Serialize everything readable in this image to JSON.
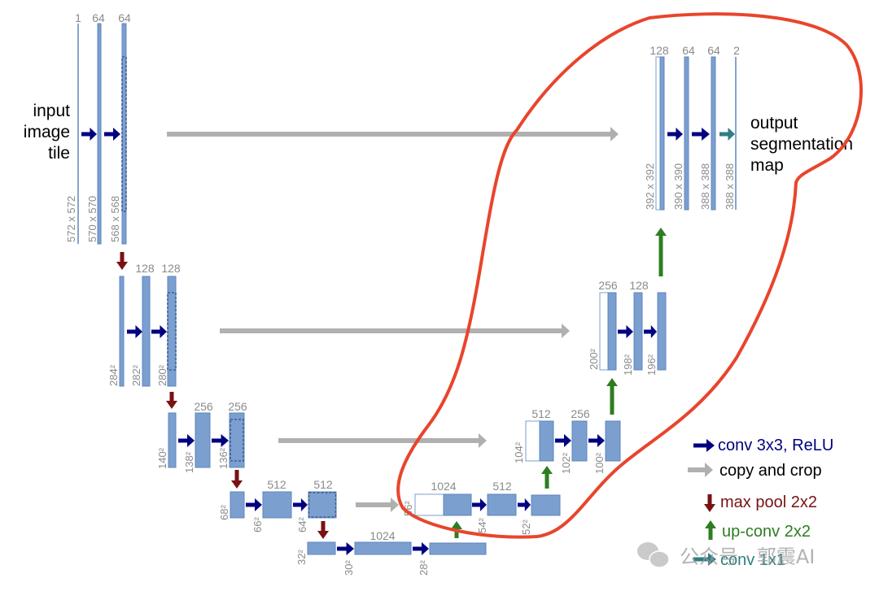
{
  "input_label": [
    "input",
    "image",
    "tile"
  ],
  "output_label": [
    "output",
    "segmentation",
    "map"
  ],
  "channels": {
    "l1_enc": [
      "1",
      "64",
      "64"
    ],
    "l2_enc": [
      "128",
      "128"
    ],
    "l3_enc": [
      "256",
      "256"
    ],
    "l4_enc": [
      "512",
      "512"
    ],
    "l5": [
      "1024"
    ],
    "l4_dec": [
      "1024",
      "512"
    ],
    "l3_dec": [
      "512",
      "256"
    ],
    "l2_dec": [
      "256",
      "128"
    ],
    "l1_dec": [
      "128",
      "64",
      "64",
      "2"
    ]
  },
  "sizes": {
    "l1_enc": [
      "572 x 572",
      "570 x 570",
      "568 x 568"
    ],
    "l2_enc": [
      "284²",
      "282²",
      "280²"
    ],
    "l3_enc": [
      "140²",
      "138²",
      "136²"
    ],
    "l4_enc": [
      "68²",
      "66²",
      "64²"
    ],
    "l5": [
      "32²",
      "30²",
      "28²"
    ],
    "l4_dec": [
      "56²",
      "54²",
      "52²"
    ],
    "l3_dec": [
      "104²",
      "102²",
      "100²"
    ],
    "l2_dec": [
      "200²",
      "198²",
      "196²"
    ],
    "l1_dec": [
      "392 x 392",
      "390 x 390",
      "388 x 388",
      "388 x 388"
    ]
  },
  "legend": [
    {
      "label": "conv 3x3, ReLU",
      "color": "#000080",
      "icon": "right-arrow-icon"
    },
    {
      "label": "copy and crop",
      "color": "#000000",
      "icon": "gray-right-arrow-icon"
    },
    {
      "label": "max pool 2x2",
      "color": "#7a1212",
      "icon": "down-arrow-icon"
    },
    {
      "label": "up-conv 2x2",
      "color": "#2e7d22",
      "icon": "up-arrow-icon"
    },
    {
      "label": "conv 1x1",
      "color": "#2f7f80",
      "icon": "teal-right-arrow-icon"
    }
  ],
  "watermark": {
    "text": "公众号 · 郭震AI",
    "icon": "wechat-icon"
  },
  "colors": {
    "feature_map": "#7b9fcf",
    "conv": "#000080",
    "copy": "#b0b0b0",
    "pool": "#7a1212",
    "upconv": "#2e7d22",
    "conv1x1": "#2f7f80",
    "annotation": "#e8452c"
  }
}
